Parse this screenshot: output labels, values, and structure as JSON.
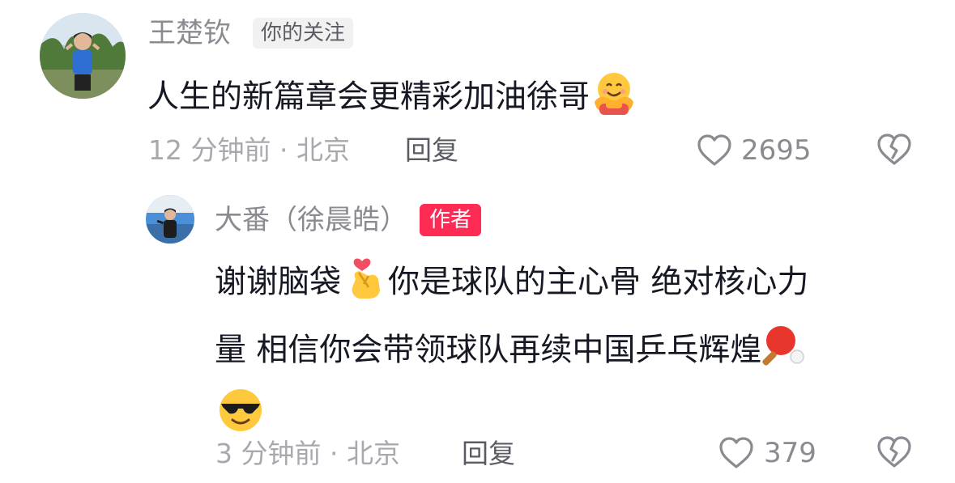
{
  "comments": [
    {
      "username": "王楚钦",
      "badge": "你的关注",
      "text": "人生的新篇章会更精彩加油徐哥",
      "emoji": [
        "hugging-face-icon"
      ],
      "time_location": "12 分钟前 · 北京",
      "reply_label": "回复",
      "likes": "2695"
    }
  ],
  "reply": {
    "username": "大番（徐晨皓）",
    "badge": "作者",
    "text_line1": "谢谢脑袋",
    "text_line1b": "你是球队的主心骨 绝对核心力",
    "text_line2": "量 相信你会带领球队再续中国乒乓辉煌",
    "emoji": [
      "finger-heart-icon",
      "ping-pong-icon",
      "sunglasses-face-icon"
    ],
    "time_location": "3 分钟前 · 北京",
    "reply_label": "回复",
    "likes": "379"
  },
  "colors": {
    "author_badge": "#fe2c55",
    "secondary_text": "#8a8b91",
    "primary_text": "#161823"
  }
}
